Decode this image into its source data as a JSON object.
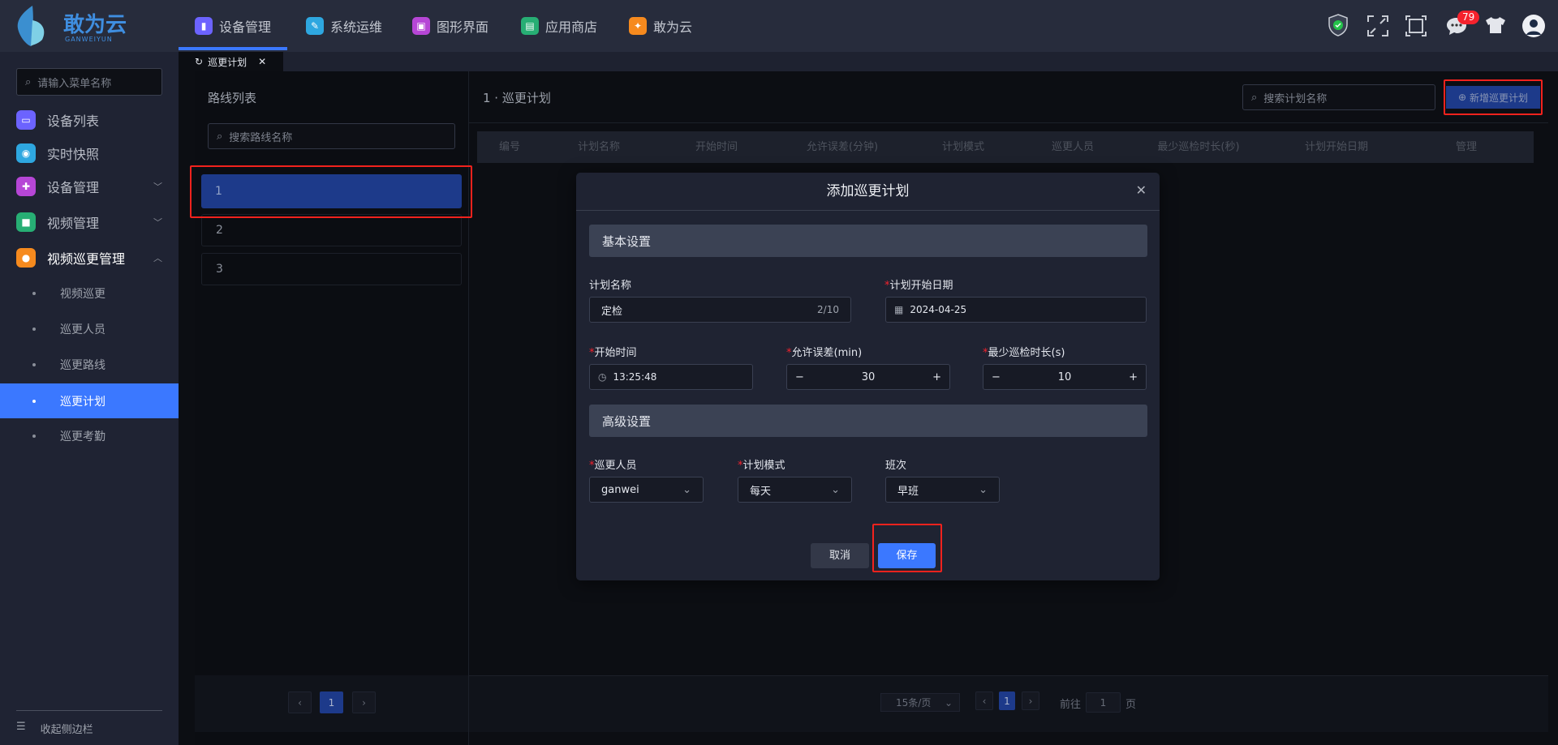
{
  "app": {
    "brand": "敢为云",
    "brand_sub": "GANWEIYUN",
    "badge_count": "79",
    "accent": "#3b78ff"
  },
  "nav": [
    {
      "label": "设备管理",
      "icon": "device-icon",
      "color": "#6c63ff"
    },
    {
      "label": "系统运维",
      "icon": "wrench-icon",
      "color": "#2ea7e0"
    },
    {
      "label": "图形界面",
      "icon": "monitor-icon",
      "color": "#b646d6"
    },
    {
      "label": "应用商店",
      "icon": "store-icon",
      "color": "#27ae74"
    },
    {
      "label": "敢为云",
      "icon": "cloud-app-icon",
      "color": "#f68a1e"
    }
  ],
  "tab": {
    "label": "巡更计划"
  },
  "sidebar": {
    "search_placeholder": "请输入菜单名称",
    "items": [
      {
        "label": "设备列表",
        "color": "#6c63ff"
      },
      {
        "label": "实时快照",
        "color": "#2ea7e0"
      },
      {
        "label": "设备管理",
        "color": "#b646d6"
      },
      {
        "label": "视频管理",
        "color": "#27ae74"
      },
      {
        "label": "视频巡更管理",
        "color": "#f68a1e"
      }
    ],
    "sub": [
      "视频巡更",
      "巡更人员",
      "巡更路线",
      "巡更计划",
      "巡更考勤"
    ],
    "collapse": "收起侧边栏"
  },
  "routes": {
    "title": "路线列表",
    "search_placeholder": "搜索路线名称",
    "items": [
      "1",
      "2",
      "3"
    ],
    "page": "1"
  },
  "plans": {
    "title": "1 · 巡更计划",
    "search_placeholder": "搜索计划名称",
    "add_button": "新增巡更计划",
    "columns": [
      "编号",
      "计划名称",
      "开始时间",
      "允许误差(分钟)",
      "计划模式",
      "巡更人员",
      "最少巡检时长(秒)",
      "计划开始日期",
      "管理"
    ],
    "page_size": "15条/页",
    "page": "1",
    "goto_label": "前往",
    "goto_value": "1",
    "page_suffix": "页"
  },
  "modal": {
    "title": "添加巡更计划",
    "basic": "基本设置",
    "advanced": "高级设置",
    "name_label": "计划名称",
    "name_value": "定检",
    "name_count": "2/10",
    "date_label": "计划开始日期",
    "date_value": "2024-04-25",
    "time_label": "开始时间",
    "time_value": "13:25:48",
    "tol_label": "允许误差(min)",
    "tol_value": "30",
    "min_label": "最少巡检时长(s)",
    "min_value": "10",
    "person_label": "巡更人员",
    "person_value": "ganwei",
    "mode_label": "计划模式",
    "mode_value": "每天",
    "shift_label": "班次",
    "shift_value": "早班",
    "cancel": "取消",
    "save": "保存"
  }
}
